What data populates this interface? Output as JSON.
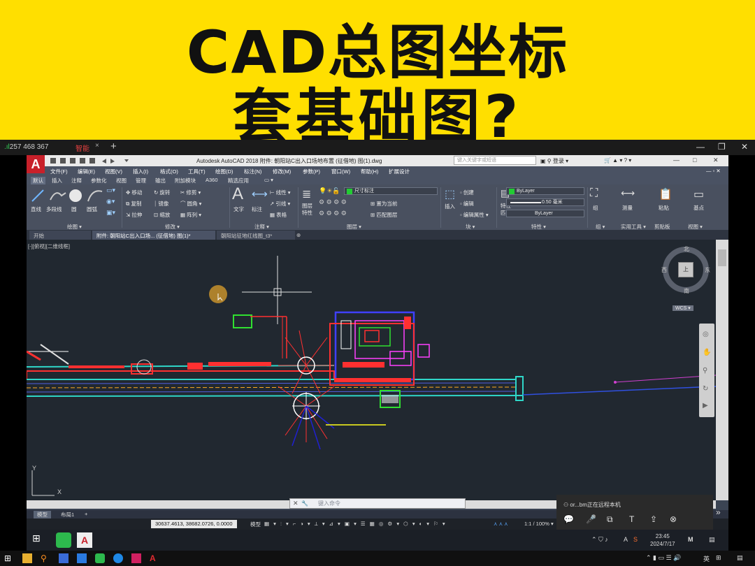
{
  "banner": {
    "line1": "CAD总图坐标",
    "line2": "套基础图?"
  },
  "remote_bar": {
    "id_prefix": ".ıl",
    "connection_id": "257 468 367",
    "session_tab": "智能",
    "tab_close": "×",
    "new_tab": "+",
    "minimize": "—",
    "restore": "❐",
    "close": "✕"
  },
  "acad": {
    "logo": "A",
    "title": "Autodesk AutoCAD 2018  附件: 朝阳站C出入口场地布置 (征借地) 图(1).dwg",
    "search_placeholder": "键入关键字或短语",
    "login": "登录",
    "help": "?",
    "win_min": "—",
    "win_max": "□",
    "win_close": "✕",
    "menubar": [
      "文件(F)",
      "编辑(E)",
      "视图(V)",
      "插入(I)",
      "格式(O)",
      "工具(T)",
      "绘图(D)",
      "标注(N)",
      "修改(M)",
      "参数(P)",
      "窗口(W)",
      "帮助(H)",
      "扩展设计"
    ],
    "ribbon_tabs": [
      "默认",
      "插入",
      "注释",
      "参数化",
      "视图",
      "管理",
      "输出",
      "附加模块",
      "A360",
      "精选应用"
    ],
    "active_ribbon_tab": "默认",
    "ribbon": {
      "draw": {
        "line": "直线",
        "polyline": "多段线",
        "circle": "圆",
        "arc": "圆弧",
        "panel": "绘图 ▾"
      },
      "modify": {
        "move": "移动",
        "rotate": "旋转",
        "trim": "修剪",
        "copy": "复制",
        "mirror": "镜像",
        "fillet": "圆角",
        "stretch": "拉伸",
        "scale": "缩放",
        "array": "阵列",
        "panel": "修改 ▾"
      },
      "annotation": {
        "text": "文字",
        "dimension": "标注",
        "linear": "线性",
        "leader": "引线",
        "table": "表格",
        "panel": "注释 ▾"
      },
      "layers": {
        "layer_props": "图层\n特性",
        "layer_name": "尺寸标注",
        "make_current": "置为当前",
        "match_layer": "匹配图层",
        "panel": "图层 ▾"
      },
      "block": {
        "insert": "插入",
        "create": "创建",
        "edit": "编辑",
        "edit_attr": "编辑属性",
        "panel": "块 ▾"
      },
      "properties": {
        "match": "特性\n匹配",
        "color": "ByLayer",
        "lineweight": "0.50 毫米",
        "linetype": "ByLayer",
        "panel": "特性 ▾"
      },
      "groups": {
        "group": "组",
        "panel": "组 ▾"
      },
      "utilities": {
        "measure": "测量",
        "panel": "实用工具 ▾"
      },
      "clipboard": {
        "paste": "粘贴",
        "panel": "剪贴板"
      },
      "view": {
        "base": "基点",
        "panel": "视图 ▾"
      }
    },
    "doc_tabs": [
      "开始",
      "附件: 朝阳站C出入口场... (征借地) 图(1)*",
      "朝阳站征地红线图_t3*"
    ],
    "active_doc_tab": 1,
    "viewport_label": "[-][俯视][二维线框]",
    "viewcube": {
      "north": "北",
      "south": "南",
      "west": "西",
      "east": "东",
      "top": "上",
      "wcs": "WCS ▾"
    },
    "ucs": {
      "y": "Y",
      "x": "X"
    },
    "command_placeholder": "键入命令",
    "command_close": "✕",
    "layout_tabs": [
      "模型",
      "布局1",
      "+"
    ],
    "active_layout_tab": "模型",
    "status": {
      "coords": "30637.4613, 38682.0726, 0.0000",
      "model": "模型",
      "scale": "1:1 / 100% ▾"
    }
  },
  "remote_panel": {
    "message": "or...bm正在远程本机",
    "expand": "»"
  },
  "inner_taskbar": {
    "time": "23:45",
    "date": "2024/7/17",
    "ime": "英",
    "tray_a": "A"
  },
  "local_taskbar": {
    "ime": "英",
    "time": "",
    "date": ""
  },
  "colors": {
    "banner": "#ffdf00",
    "drawing_bg": "#212830",
    "ribbon_bg": "#49505f",
    "acad_red": "#c8202a"
  }
}
